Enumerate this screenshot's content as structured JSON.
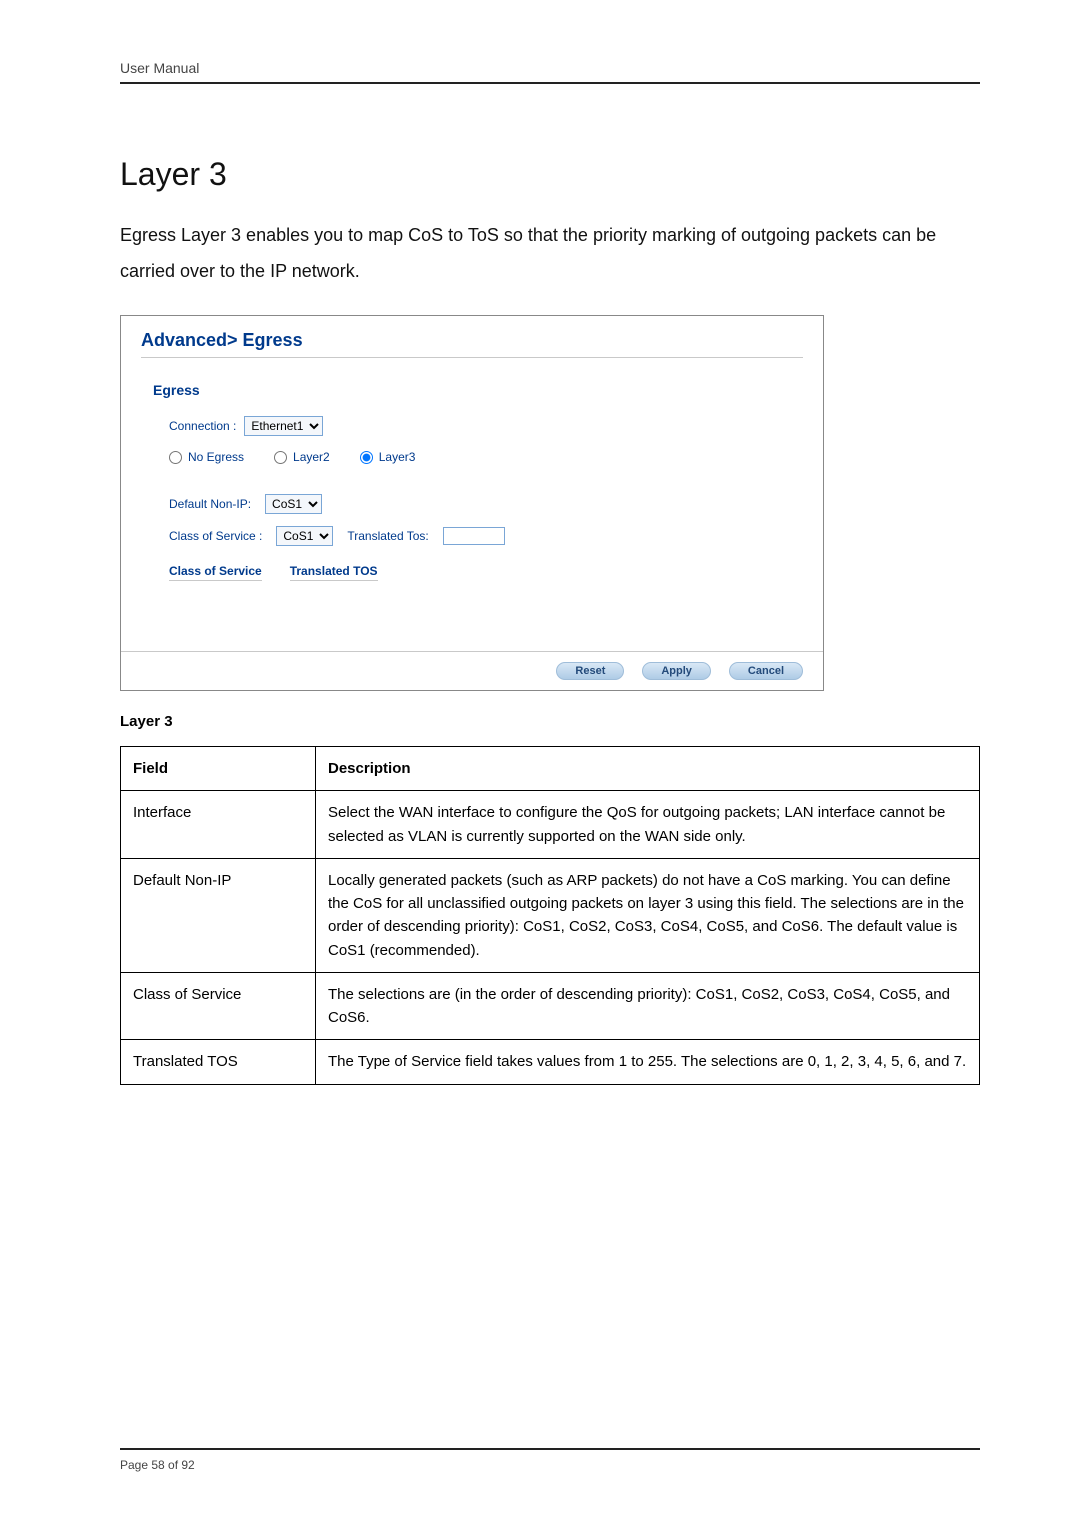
{
  "header": {
    "label": "User Manual"
  },
  "title": "Layer 3",
  "intro": "Egress Layer 3 enables you to map CoS to ToS so that the priority marking of outgoing packets can be carried over to the IP network.",
  "screenshot": {
    "title": "Advanced> Egress",
    "section": "Egress",
    "connection_label": "Connection :",
    "connection_value": "Ethernet1",
    "radios": {
      "no_egress": "No Egress",
      "layer2": "Layer2",
      "layer3": "Layer3"
    },
    "default_non_ip_label": "Default Non-IP:",
    "default_non_ip_value": "CoS1",
    "class_of_service_label": "Class of Service :",
    "class_of_service_value": "CoS1",
    "translated_tos_label": "Translated Tos:",
    "translated_tos_value": "",
    "headers": {
      "cos": "Class of Service",
      "ttos": "Translated TOS"
    },
    "buttons": {
      "reset": "Reset",
      "apply": "Apply",
      "cancel": "Cancel"
    }
  },
  "caption": "Layer 3",
  "table": {
    "head": {
      "field": "Field",
      "desc": "Description"
    },
    "rows": [
      {
        "field": "Interface",
        "desc": "Select the WAN interface to configure the QoS for outgoing packets; LAN interface cannot be selected as VLAN is currently supported on the WAN side only."
      },
      {
        "field": "Default Non-IP",
        "desc": "Locally generated packets (such as ARP packets) do not have a CoS marking. You can define the CoS for all unclassified outgoing packets on layer 3 using this field. The selections are in the order of descending priority): CoS1, CoS2, CoS3, CoS4, CoS5, and CoS6. The default value is CoS1 (recommended)."
      },
      {
        "field": "Class of Service",
        "desc": "The selections are (in the order of descending priority): CoS1, CoS2, CoS3, CoS4, CoS5, and CoS6."
      },
      {
        "field": "Translated TOS",
        "desc": "The Type of Service field takes values from 1 to 255. The selections are 0, 1, 2, 3, 4, 5, 6, and 7."
      }
    ]
  },
  "footer": {
    "page": "Page 58 of 92"
  }
}
